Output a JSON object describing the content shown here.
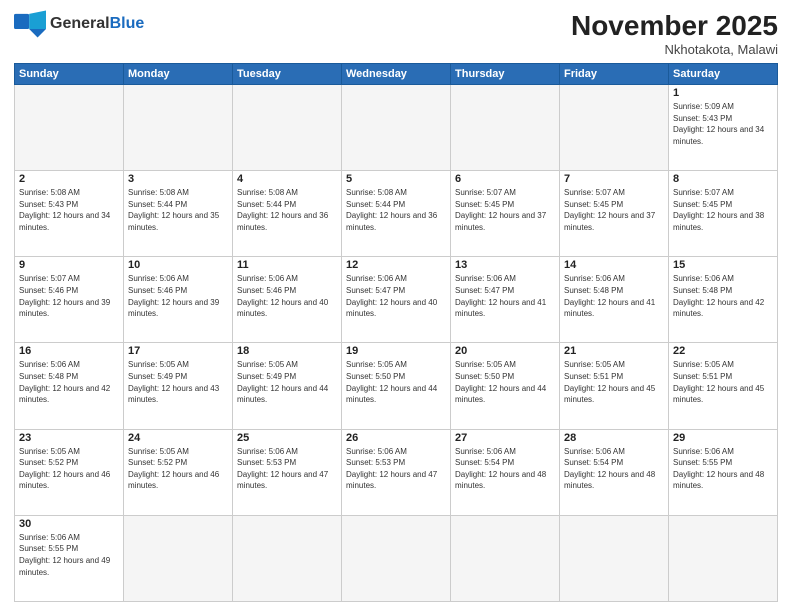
{
  "header": {
    "logo_general": "General",
    "logo_blue": "Blue",
    "month_year": "November 2025",
    "location": "Nkhotakota, Malawi"
  },
  "days_of_week": [
    "Sunday",
    "Monday",
    "Tuesday",
    "Wednesday",
    "Thursday",
    "Friday",
    "Saturday"
  ],
  "cells": [
    {
      "day": "",
      "empty": true
    },
    {
      "day": "",
      "empty": true
    },
    {
      "day": "",
      "empty": true
    },
    {
      "day": "",
      "empty": true
    },
    {
      "day": "",
      "empty": true
    },
    {
      "day": "",
      "empty": true
    },
    {
      "day": "1",
      "sunrise": "5:09 AM",
      "sunset": "5:43 PM",
      "daylight": "12 hours and 34 minutes."
    },
    {
      "day": "2",
      "sunrise": "5:08 AM",
      "sunset": "5:43 PM",
      "daylight": "12 hours and 34 minutes."
    },
    {
      "day": "3",
      "sunrise": "5:08 AM",
      "sunset": "5:44 PM",
      "daylight": "12 hours and 35 minutes."
    },
    {
      "day": "4",
      "sunrise": "5:08 AM",
      "sunset": "5:44 PM",
      "daylight": "12 hours and 36 minutes."
    },
    {
      "day": "5",
      "sunrise": "5:08 AM",
      "sunset": "5:44 PM",
      "daylight": "12 hours and 36 minutes."
    },
    {
      "day": "6",
      "sunrise": "5:07 AM",
      "sunset": "5:45 PM",
      "daylight": "12 hours and 37 minutes."
    },
    {
      "day": "7",
      "sunrise": "5:07 AM",
      "sunset": "5:45 PM",
      "daylight": "12 hours and 37 minutes."
    },
    {
      "day": "8",
      "sunrise": "5:07 AM",
      "sunset": "5:45 PM",
      "daylight": "12 hours and 38 minutes."
    },
    {
      "day": "9",
      "sunrise": "5:07 AM",
      "sunset": "5:46 PM",
      "daylight": "12 hours and 39 minutes."
    },
    {
      "day": "10",
      "sunrise": "5:06 AM",
      "sunset": "5:46 PM",
      "daylight": "12 hours and 39 minutes."
    },
    {
      "day": "11",
      "sunrise": "5:06 AM",
      "sunset": "5:46 PM",
      "daylight": "12 hours and 40 minutes."
    },
    {
      "day": "12",
      "sunrise": "5:06 AM",
      "sunset": "5:47 PM",
      "daylight": "12 hours and 40 minutes."
    },
    {
      "day": "13",
      "sunrise": "5:06 AM",
      "sunset": "5:47 PM",
      "daylight": "12 hours and 41 minutes."
    },
    {
      "day": "14",
      "sunrise": "5:06 AM",
      "sunset": "5:48 PM",
      "daylight": "12 hours and 41 minutes."
    },
    {
      "day": "15",
      "sunrise": "5:06 AM",
      "sunset": "5:48 PM",
      "daylight": "12 hours and 42 minutes."
    },
    {
      "day": "16",
      "sunrise": "5:06 AM",
      "sunset": "5:48 PM",
      "daylight": "12 hours and 42 minutes."
    },
    {
      "day": "17",
      "sunrise": "5:05 AM",
      "sunset": "5:49 PM",
      "daylight": "12 hours and 43 minutes."
    },
    {
      "day": "18",
      "sunrise": "5:05 AM",
      "sunset": "5:49 PM",
      "daylight": "12 hours and 44 minutes."
    },
    {
      "day": "19",
      "sunrise": "5:05 AM",
      "sunset": "5:50 PM",
      "daylight": "12 hours and 44 minutes."
    },
    {
      "day": "20",
      "sunrise": "5:05 AM",
      "sunset": "5:50 PM",
      "daylight": "12 hours and 44 minutes."
    },
    {
      "day": "21",
      "sunrise": "5:05 AM",
      "sunset": "5:51 PM",
      "daylight": "12 hours and 45 minutes."
    },
    {
      "day": "22",
      "sunrise": "5:05 AM",
      "sunset": "5:51 PM",
      "daylight": "12 hours and 45 minutes."
    },
    {
      "day": "23",
      "sunrise": "5:05 AM",
      "sunset": "5:52 PM",
      "daylight": "12 hours and 46 minutes."
    },
    {
      "day": "24",
      "sunrise": "5:05 AM",
      "sunset": "5:52 PM",
      "daylight": "12 hours and 46 minutes."
    },
    {
      "day": "25",
      "sunrise": "5:06 AM",
      "sunset": "5:53 PM",
      "daylight": "12 hours and 47 minutes."
    },
    {
      "day": "26",
      "sunrise": "5:06 AM",
      "sunset": "5:53 PM",
      "daylight": "12 hours and 47 minutes."
    },
    {
      "day": "27",
      "sunrise": "5:06 AM",
      "sunset": "5:54 PM",
      "daylight": "12 hours and 48 minutes."
    },
    {
      "day": "28",
      "sunrise": "5:06 AM",
      "sunset": "5:54 PM",
      "daylight": "12 hours and 48 minutes."
    },
    {
      "day": "29",
      "sunrise": "5:06 AM",
      "sunset": "5:55 PM",
      "daylight": "12 hours and 48 minutes."
    },
    {
      "day": "30",
      "sunrise": "5:06 AM",
      "sunset": "5:55 PM",
      "daylight": "12 hours and 49 minutes."
    },
    {
      "day": "",
      "empty": true
    },
    {
      "day": "",
      "empty": true
    },
    {
      "day": "",
      "empty": true
    },
    {
      "day": "",
      "empty": true
    },
    {
      "day": "",
      "empty": true
    },
    {
      "day": "",
      "empty": true
    }
  ],
  "labels": {
    "sunrise": "Sunrise:",
    "sunset": "Sunset:",
    "daylight": "Daylight:"
  }
}
